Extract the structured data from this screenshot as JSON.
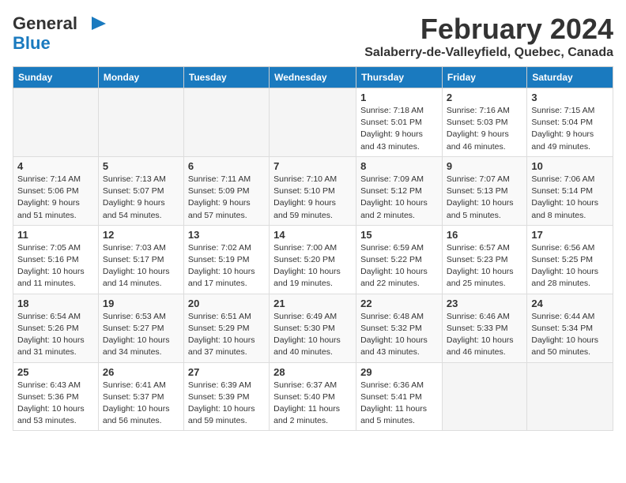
{
  "header": {
    "logo_line1": "General",
    "logo_line2": "Blue",
    "main_title": "February 2024",
    "subtitle": "Salaberry-de-Valleyfield, Quebec, Canada"
  },
  "weekdays": [
    "Sunday",
    "Monday",
    "Tuesday",
    "Wednesday",
    "Thursday",
    "Friday",
    "Saturday"
  ],
  "weeks": [
    [
      {
        "day": "",
        "detail": ""
      },
      {
        "day": "",
        "detail": ""
      },
      {
        "day": "",
        "detail": ""
      },
      {
        "day": "",
        "detail": ""
      },
      {
        "day": "1",
        "detail": "Sunrise: 7:18 AM\nSunset: 5:01 PM\nDaylight: 9 hours\nand 43 minutes."
      },
      {
        "day": "2",
        "detail": "Sunrise: 7:16 AM\nSunset: 5:03 PM\nDaylight: 9 hours\nand 46 minutes."
      },
      {
        "day": "3",
        "detail": "Sunrise: 7:15 AM\nSunset: 5:04 PM\nDaylight: 9 hours\nand 49 minutes."
      }
    ],
    [
      {
        "day": "4",
        "detail": "Sunrise: 7:14 AM\nSunset: 5:06 PM\nDaylight: 9 hours\nand 51 minutes."
      },
      {
        "day": "5",
        "detail": "Sunrise: 7:13 AM\nSunset: 5:07 PM\nDaylight: 9 hours\nand 54 minutes."
      },
      {
        "day": "6",
        "detail": "Sunrise: 7:11 AM\nSunset: 5:09 PM\nDaylight: 9 hours\nand 57 minutes."
      },
      {
        "day": "7",
        "detail": "Sunrise: 7:10 AM\nSunset: 5:10 PM\nDaylight: 9 hours\nand 59 minutes."
      },
      {
        "day": "8",
        "detail": "Sunrise: 7:09 AM\nSunset: 5:12 PM\nDaylight: 10 hours\nand 2 minutes."
      },
      {
        "day": "9",
        "detail": "Sunrise: 7:07 AM\nSunset: 5:13 PM\nDaylight: 10 hours\nand 5 minutes."
      },
      {
        "day": "10",
        "detail": "Sunrise: 7:06 AM\nSunset: 5:14 PM\nDaylight: 10 hours\nand 8 minutes."
      }
    ],
    [
      {
        "day": "11",
        "detail": "Sunrise: 7:05 AM\nSunset: 5:16 PM\nDaylight: 10 hours\nand 11 minutes."
      },
      {
        "day": "12",
        "detail": "Sunrise: 7:03 AM\nSunset: 5:17 PM\nDaylight: 10 hours\nand 14 minutes."
      },
      {
        "day": "13",
        "detail": "Sunrise: 7:02 AM\nSunset: 5:19 PM\nDaylight: 10 hours\nand 17 minutes."
      },
      {
        "day": "14",
        "detail": "Sunrise: 7:00 AM\nSunset: 5:20 PM\nDaylight: 10 hours\nand 19 minutes."
      },
      {
        "day": "15",
        "detail": "Sunrise: 6:59 AM\nSunset: 5:22 PM\nDaylight: 10 hours\nand 22 minutes."
      },
      {
        "day": "16",
        "detail": "Sunrise: 6:57 AM\nSunset: 5:23 PM\nDaylight: 10 hours\nand 25 minutes."
      },
      {
        "day": "17",
        "detail": "Sunrise: 6:56 AM\nSunset: 5:25 PM\nDaylight: 10 hours\nand 28 minutes."
      }
    ],
    [
      {
        "day": "18",
        "detail": "Sunrise: 6:54 AM\nSunset: 5:26 PM\nDaylight: 10 hours\nand 31 minutes."
      },
      {
        "day": "19",
        "detail": "Sunrise: 6:53 AM\nSunset: 5:27 PM\nDaylight: 10 hours\nand 34 minutes."
      },
      {
        "day": "20",
        "detail": "Sunrise: 6:51 AM\nSunset: 5:29 PM\nDaylight: 10 hours\nand 37 minutes."
      },
      {
        "day": "21",
        "detail": "Sunrise: 6:49 AM\nSunset: 5:30 PM\nDaylight: 10 hours\nand 40 minutes."
      },
      {
        "day": "22",
        "detail": "Sunrise: 6:48 AM\nSunset: 5:32 PM\nDaylight: 10 hours\nand 43 minutes."
      },
      {
        "day": "23",
        "detail": "Sunrise: 6:46 AM\nSunset: 5:33 PM\nDaylight: 10 hours\nand 46 minutes."
      },
      {
        "day": "24",
        "detail": "Sunrise: 6:44 AM\nSunset: 5:34 PM\nDaylight: 10 hours\nand 50 minutes."
      }
    ],
    [
      {
        "day": "25",
        "detail": "Sunrise: 6:43 AM\nSunset: 5:36 PM\nDaylight: 10 hours\nand 53 minutes."
      },
      {
        "day": "26",
        "detail": "Sunrise: 6:41 AM\nSunset: 5:37 PM\nDaylight: 10 hours\nand 56 minutes."
      },
      {
        "day": "27",
        "detail": "Sunrise: 6:39 AM\nSunset: 5:39 PM\nDaylight: 10 hours\nand 59 minutes."
      },
      {
        "day": "28",
        "detail": "Sunrise: 6:37 AM\nSunset: 5:40 PM\nDaylight: 11 hours\nand 2 minutes."
      },
      {
        "day": "29",
        "detail": "Sunrise: 6:36 AM\nSunset: 5:41 PM\nDaylight: 11 hours\nand 5 minutes."
      },
      {
        "day": "",
        "detail": ""
      },
      {
        "day": "",
        "detail": ""
      }
    ]
  ]
}
